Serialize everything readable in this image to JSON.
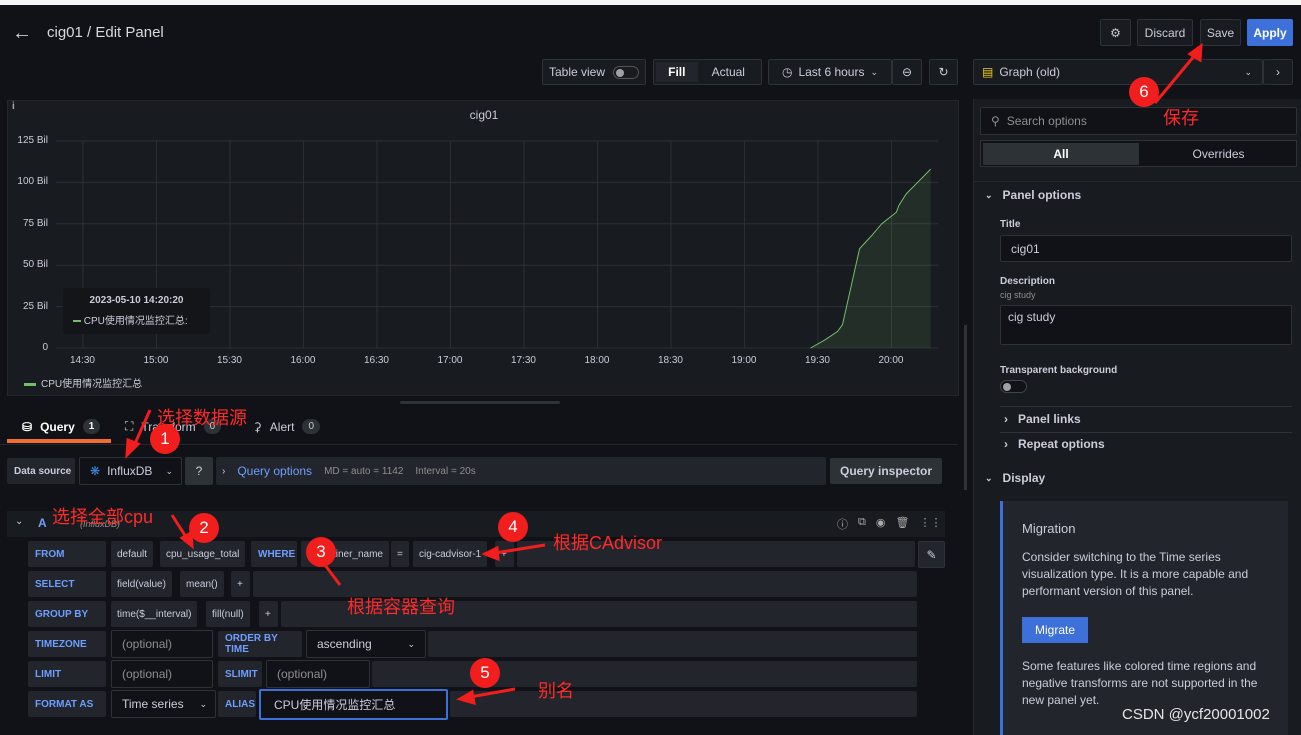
{
  "header": {
    "title": "cig01 / Edit Panel",
    "discard": "Discard",
    "save": "Save",
    "apply": "Apply"
  },
  "toolbar": {
    "table_view": "Table view",
    "fill": "Fill",
    "actual": "Actual",
    "time_range": "Last 6 hours"
  },
  "viz": {
    "name": "Graph (old)"
  },
  "options": {
    "search_placeholder": "Search options",
    "tab_all": "All",
    "tab_overrides": "Overrides",
    "panel_options": "Panel options",
    "title_label": "Title",
    "title_value": "cig01",
    "description_label": "Description",
    "description_hint": "cig study",
    "description_value": "cig study",
    "transparent_label": "Transparent background",
    "transparent_on": false,
    "panel_links": "Panel links",
    "repeat_options": "Repeat options",
    "display": "Display",
    "migration": {
      "title": "Migration",
      "text1": "Consider switching to the Time series visualization type. It is a more capable and performant version of this panel.",
      "button": "Migrate",
      "text2": "Some features like colored time regions and negative transforms are not supported in the new panel yet."
    }
  },
  "chart_data": {
    "type": "area",
    "title": "cig01",
    "series": [
      {
        "name": "CPU使用情况监控汇总",
        "color": "#73bf69",
        "x": [
          "19:27",
          "19:33",
          "19:38",
          "19:40",
          "19:47",
          "19:52",
          "19:56",
          "20:02",
          "20:03",
          "20:06",
          "20:10",
          "20:16"
        ],
        "values": [
          0,
          5,
          10,
          14,
          60,
          68,
          75,
          82,
          86,
          93,
          99,
          108
        ]
      }
    ],
    "yticks": [
      "0",
      "25 Bil",
      "50 Bil",
      "75 Bil",
      "100 Bil",
      "125 Bil"
    ],
    "ylim": [
      0,
      125
    ],
    "xticks": [
      "14:30",
      "15:00",
      "15:30",
      "16:00",
      "16:30",
      "17:00",
      "17:30",
      "18:00",
      "18:30",
      "19:00",
      "19:30",
      "20:00"
    ],
    "xlim": [
      "14:19",
      "20:19"
    ],
    "tooltip": {
      "time": "2023-05-10 14:20:20",
      "series": "CPU使用情况监控汇总:"
    },
    "legend": "bottom-left",
    "grid": true
  },
  "tabs": {
    "query": "Query",
    "query_count": "1",
    "transform": "Transform",
    "transform_count": "0",
    "alert": "Alert",
    "alert_count": "0"
  },
  "query": {
    "datasource_label": "Data source",
    "datasource": "InfluxDB",
    "query_options": "Query options",
    "md": "MD = auto = 1142",
    "interval": "Interval = 20s",
    "inspector": "Query inspector",
    "ref": "A",
    "ref_ds": "(InfluxDB)",
    "from": "FROM",
    "from_policy": "default",
    "measurement": "cpu_usage_total",
    "where": "WHERE",
    "tag": "container_name",
    "op": "=",
    "tag_value": "cig-cadvisor-1",
    "select": "SELECT",
    "field": "field(value)",
    "fn": "mean()",
    "group_by": "GROUP BY",
    "time_group": "time($__interval)",
    "fill": "fill(null)",
    "timezone": "TIMEZONE",
    "optional": "(optional)",
    "order_by": "ORDER BY TIME",
    "order": "ascending",
    "limit": "LIMIT",
    "slimit": "SLIMIT",
    "format_as": "FORMAT AS",
    "format": "Time series",
    "alias": "ALIAS",
    "alias_value": "CPU使用情况监控汇总"
  },
  "annotations": {
    "n1": "1",
    "n2": "2",
    "n3": "3",
    "n4": "4",
    "n5": "5",
    "n6": "6",
    "t1": "选择数据源",
    "t2": "选择全部cpu",
    "t3": "根据容器查询",
    "t4": "根据CAdvisor",
    "t5": "别名",
    "t6": "保存"
  },
  "watermark": "CSDN @ycf20001002"
}
